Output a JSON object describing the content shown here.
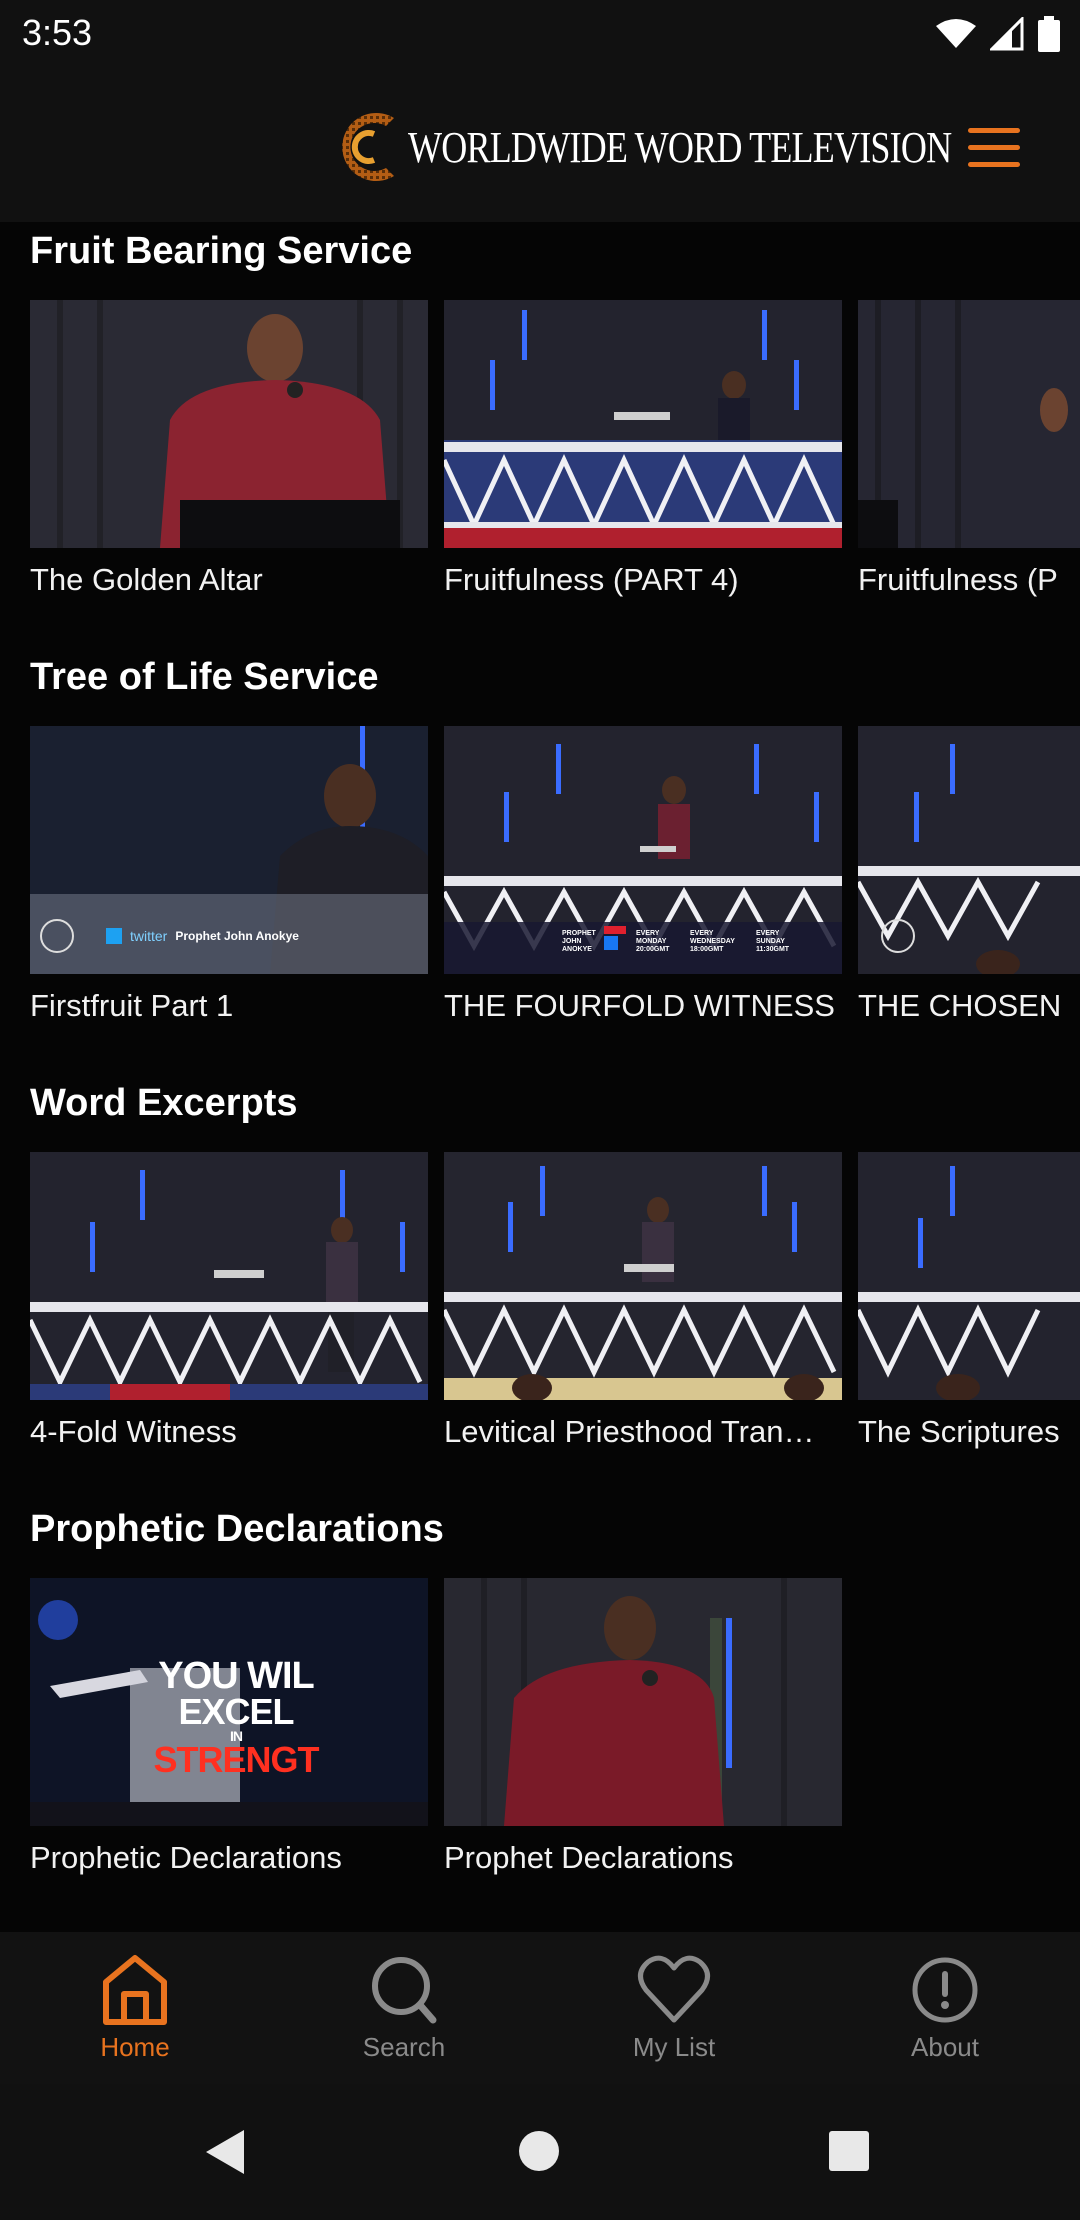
{
  "status_bar": {
    "time": "3:53",
    "icons": [
      "wifi-icon",
      "signal-icon",
      "battery-icon"
    ]
  },
  "header": {
    "logo_text": "WORLDWIDE WORD TELEVISION",
    "menu_icon": "hamburger-menu-icon"
  },
  "sections": [
    {
      "title": "Fruit Bearing Service",
      "cards": [
        {
          "title": "The Golden Altar"
        },
        {
          "title": "Fruitfulness (PART 4)"
        },
        {
          "title": "Fruitfulness (P"
        }
      ]
    },
    {
      "title": "Tree of Life Service",
      "cards": [
        {
          "title": "Firstfruit Part 1",
          "thumb_caption": "Prophet John Anokye",
          "thumb_brand": "twitter"
        },
        {
          "title": "THE FOURFOLD WITNESS",
          "thumb_banner": [
            "PROPHET JOHN ANOKYE",
            "EVERY MONDAY 20:00GMT",
            "EVERY WEDNESDAY 18:00GMT",
            "EVERY SUNDAY 11:30GMT"
          ]
        },
        {
          "title": "THE CHOSEN"
        }
      ]
    },
    {
      "title": "Word Excerpts",
      "cards": [
        {
          "title": "4-Fold Witness"
        },
        {
          "title": "Levitical Priesthood Tran…"
        },
        {
          "title": "The Scriptures"
        }
      ]
    },
    {
      "title": "Prophetic Declarations",
      "cards": [
        {
          "title": "Prophetic Declarations",
          "thumb_text": [
            "YOU WIL",
            "EXCEL",
            "IN",
            "STRENGT"
          ]
        },
        {
          "title": "Prophet Declarations"
        }
      ]
    }
  ],
  "bottom_nav": {
    "items": [
      {
        "label": "Home",
        "icon": "home-icon",
        "active": true
      },
      {
        "label": "Search",
        "icon": "search-icon",
        "active": false
      },
      {
        "label": "My List",
        "icon": "heart-icon",
        "active": false
      },
      {
        "label": "About",
        "icon": "info-circle-icon",
        "active": false
      }
    ]
  },
  "system_nav": [
    "back-icon",
    "home-circle-icon",
    "recents-square-icon"
  ],
  "colors": {
    "accent": "#e8731f",
    "background": "#050505",
    "bar": "#111111"
  }
}
